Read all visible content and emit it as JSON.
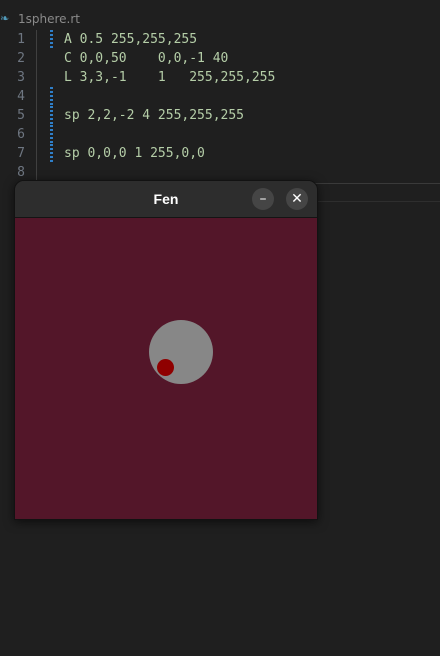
{
  "tab": {
    "filename": "1sphere.rt",
    "icon": "scene-file-icon"
  },
  "code_lines": [
    {
      "n": "1",
      "text": "A 0.5 255,255,255"
    },
    {
      "n": "2",
      "text": "C 0,0,50    0,0,-1 40"
    },
    {
      "n": "3",
      "text": "L 3,3,-1    1   255,255,255"
    },
    {
      "n": "4",
      "text": ""
    },
    {
      "n": "5",
      "text": "sp 2,2,-2 4 255,255,255"
    },
    {
      "n": "6",
      "text": ""
    },
    {
      "n": "7",
      "text": "sp 0,0,0 1 255,0,0"
    },
    {
      "n": "8",
      "text": ""
    }
  ],
  "window": {
    "title": "Fen",
    "minimize_label": "–",
    "close_label": "✕",
    "canvas_background": "#531629",
    "sphere_colors": [
      "#878787",
      "#8f0000"
    ]
  }
}
